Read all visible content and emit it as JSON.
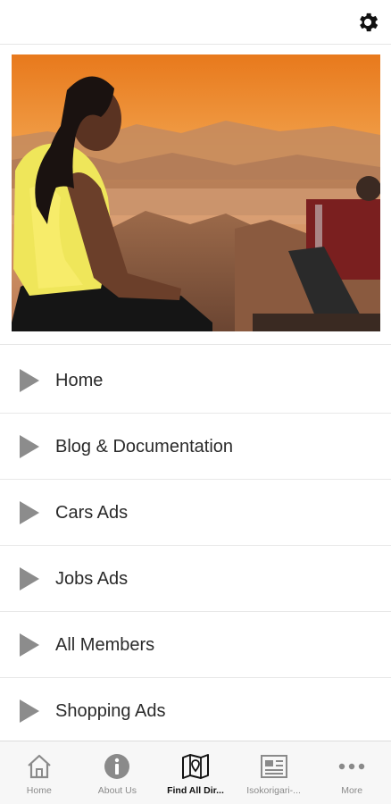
{
  "header": {
    "settings_icon": "gear-icon"
  },
  "menu": {
    "items": [
      {
        "label": "Home",
        "icon": "play-triangle-icon"
      },
      {
        "label": "Blog & Documentation",
        "icon": "play-triangle-icon"
      },
      {
        "label": "Cars Ads",
        "icon": "play-triangle-icon"
      },
      {
        "label": "Jobs Ads",
        "icon": "play-triangle-icon"
      },
      {
        "label": "All Members",
        "icon": "play-triangle-icon"
      },
      {
        "label": "Shopping Ads",
        "icon": "play-triangle-icon"
      }
    ]
  },
  "tabbar": {
    "tabs": [
      {
        "label": "Home",
        "icon": "house-icon",
        "active": false
      },
      {
        "label": "About Us",
        "icon": "info-icon",
        "active": false
      },
      {
        "label": "Find All Dir...",
        "icon": "map-pin-icon",
        "active": true
      },
      {
        "label": "Isokorigari-...",
        "icon": "newspaper-icon",
        "active": false
      },
      {
        "label": "More",
        "icon": "more-dots-icon",
        "active": false
      }
    ]
  },
  "colors": {
    "accent": "#111111",
    "inactive": "#8a8a8a",
    "triangle": "#8c8c8c"
  }
}
